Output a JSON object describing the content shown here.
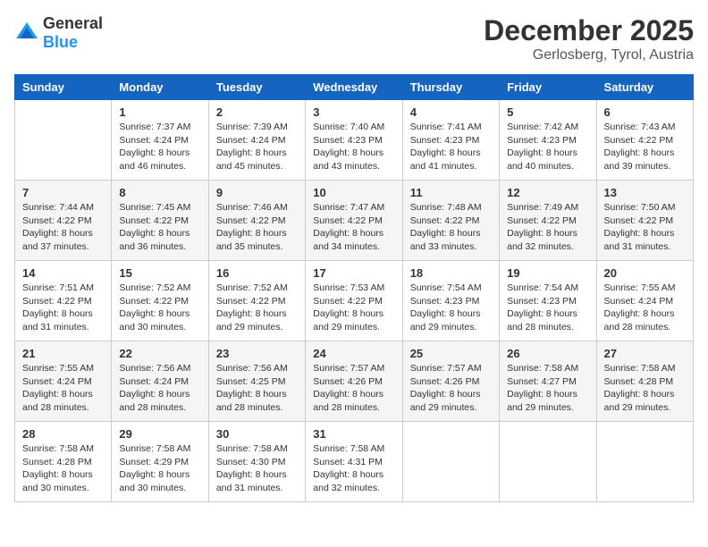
{
  "logo": {
    "general": "General",
    "blue": "Blue"
  },
  "title": "December 2025",
  "location": "Gerlosberg, Tyrol, Austria",
  "days_of_week": [
    "Sunday",
    "Monday",
    "Tuesday",
    "Wednesday",
    "Thursday",
    "Friday",
    "Saturday"
  ],
  "weeks": [
    [
      {
        "day": "",
        "sunrise": "",
        "sunset": "",
        "daylight": ""
      },
      {
        "day": "1",
        "sunrise": "Sunrise: 7:37 AM",
        "sunset": "Sunset: 4:24 PM",
        "daylight": "Daylight: 8 hours and 46 minutes."
      },
      {
        "day": "2",
        "sunrise": "Sunrise: 7:39 AM",
        "sunset": "Sunset: 4:24 PM",
        "daylight": "Daylight: 8 hours and 45 minutes."
      },
      {
        "day": "3",
        "sunrise": "Sunrise: 7:40 AM",
        "sunset": "Sunset: 4:23 PM",
        "daylight": "Daylight: 8 hours and 43 minutes."
      },
      {
        "day": "4",
        "sunrise": "Sunrise: 7:41 AM",
        "sunset": "Sunset: 4:23 PM",
        "daylight": "Daylight: 8 hours and 41 minutes."
      },
      {
        "day": "5",
        "sunrise": "Sunrise: 7:42 AM",
        "sunset": "Sunset: 4:23 PM",
        "daylight": "Daylight: 8 hours and 40 minutes."
      },
      {
        "day": "6",
        "sunrise": "Sunrise: 7:43 AM",
        "sunset": "Sunset: 4:22 PM",
        "daylight": "Daylight: 8 hours and 39 minutes."
      }
    ],
    [
      {
        "day": "7",
        "sunrise": "Sunrise: 7:44 AM",
        "sunset": "Sunset: 4:22 PM",
        "daylight": "Daylight: 8 hours and 37 minutes."
      },
      {
        "day": "8",
        "sunrise": "Sunrise: 7:45 AM",
        "sunset": "Sunset: 4:22 PM",
        "daylight": "Daylight: 8 hours and 36 minutes."
      },
      {
        "day": "9",
        "sunrise": "Sunrise: 7:46 AM",
        "sunset": "Sunset: 4:22 PM",
        "daylight": "Daylight: 8 hours and 35 minutes."
      },
      {
        "day": "10",
        "sunrise": "Sunrise: 7:47 AM",
        "sunset": "Sunset: 4:22 PM",
        "daylight": "Daylight: 8 hours and 34 minutes."
      },
      {
        "day": "11",
        "sunrise": "Sunrise: 7:48 AM",
        "sunset": "Sunset: 4:22 PM",
        "daylight": "Daylight: 8 hours and 33 minutes."
      },
      {
        "day": "12",
        "sunrise": "Sunrise: 7:49 AM",
        "sunset": "Sunset: 4:22 PM",
        "daylight": "Daylight: 8 hours and 32 minutes."
      },
      {
        "day": "13",
        "sunrise": "Sunrise: 7:50 AM",
        "sunset": "Sunset: 4:22 PM",
        "daylight": "Daylight: 8 hours and 31 minutes."
      }
    ],
    [
      {
        "day": "14",
        "sunrise": "Sunrise: 7:51 AM",
        "sunset": "Sunset: 4:22 PM",
        "daylight": "Daylight: 8 hours and 31 minutes."
      },
      {
        "day": "15",
        "sunrise": "Sunrise: 7:52 AM",
        "sunset": "Sunset: 4:22 PM",
        "daylight": "Daylight: 8 hours and 30 minutes."
      },
      {
        "day": "16",
        "sunrise": "Sunrise: 7:52 AM",
        "sunset": "Sunset: 4:22 PM",
        "daylight": "Daylight: 8 hours and 29 minutes."
      },
      {
        "day": "17",
        "sunrise": "Sunrise: 7:53 AM",
        "sunset": "Sunset: 4:22 PM",
        "daylight": "Daylight: 8 hours and 29 minutes."
      },
      {
        "day": "18",
        "sunrise": "Sunrise: 7:54 AM",
        "sunset": "Sunset: 4:23 PM",
        "daylight": "Daylight: 8 hours and 29 minutes."
      },
      {
        "day": "19",
        "sunrise": "Sunrise: 7:54 AM",
        "sunset": "Sunset: 4:23 PM",
        "daylight": "Daylight: 8 hours and 28 minutes."
      },
      {
        "day": "20",
        "sunrise": "Sunrise: 7:55 AM",
        "sunset": "Sunset: 4:24 PM",
        "daylight": "Daylight: 8 hours and 28 minutes."
      }
    ],
    [
      {
        "day": "21",
        "sunrise": "Sunrise: 7:55 AM",
        "sunset": "Sunset: 4:24 PM",
        "daylight": "Daylight: 8 hours and 28 minutes."
      },
      {
        "day": "22",
        "sunrise": "Sunrise: 7:56 AM",
        "sunset": "Sunset: 4:24 PM",
        "daylight": "Daylight: 8 hours and 28 minutes."
      },
      {
        "day": "23",
        "sunrise": "Sunrise: 7:56 AM",
        "sunset": "Sunset: 4:25 PM",
        "daylight": "Daylight: 8 hours and 28 minutes."
      },
      {
        "day": "24",
        "sunrise": "Sunrise: 7:57 AM",
        "sunset": "Sunset: 4:26 PM",
        "daylight": "Daylight: 8 hours and 28 minutes."
      },
      {
        "day": "25",
        "sunrise": "Sunrise: 7:57 AM",
        "sunset": "Sunset: 4:26 PM",
        "daylight": "Daylight: 8 hours and 29 minutes."
      },
      {
        "day": "26",
        "sunrise": "Sunrise: 7:58 AM",
        "sunset": "Sunset: 4:27 PM",
        "daylight": "Daylight: 8 hours and 29 minutes."
      },
      {
        "day": "27",
        "sunrise": "Sunrise: 7:58 AM",
        "sunset": "Sunset: 4:28 PM",
        "daylight": "Daylight: 8 hours and 29 minutes."
      }
    ],
    [
      {
        "day": "28",
        "sunrise": "Sunrise: 7:58 AM",
        "sunset": "Sunset: 4:28 PM",
        "daylight": "Daylight: 8 hours and 30 minutes."
      },
      {
        "day": "29",
        "sunrise": "Sunrise: 7:58 AM",
        "sunset": "Sunset: 4:29 PM",
        "daylight": "Daylight: 8 hours and 30 minutes."
      },
      {
        "day": "30",
        "sunrise": "Sunrise: 7:58 AM",
        "sunset": "Sunset: 4:30 PM",
        "daylight": "Daylight: 8 hours and 31 minutes."
      },
      {
        "day": "31",
        "sunrise": "Sunrise: 7:58 AM",
        "sunset": "Sunset: 4:31 PM",
        "daylight": "Daylight: 8 hours and 32 minutes."
      },
      {
        "day": "",
        "sunrise": "",
        "sunset": "",
        "daylight": ""
      },
      {
        "day": "",
        "sunrise": "",
        "sunset": "",
        "daylight": ""
      },
      {
        "day": "",
        "sunrise": "",
        "sunset": "",
        "daylight": ""
      }
    ]
  ]
}
